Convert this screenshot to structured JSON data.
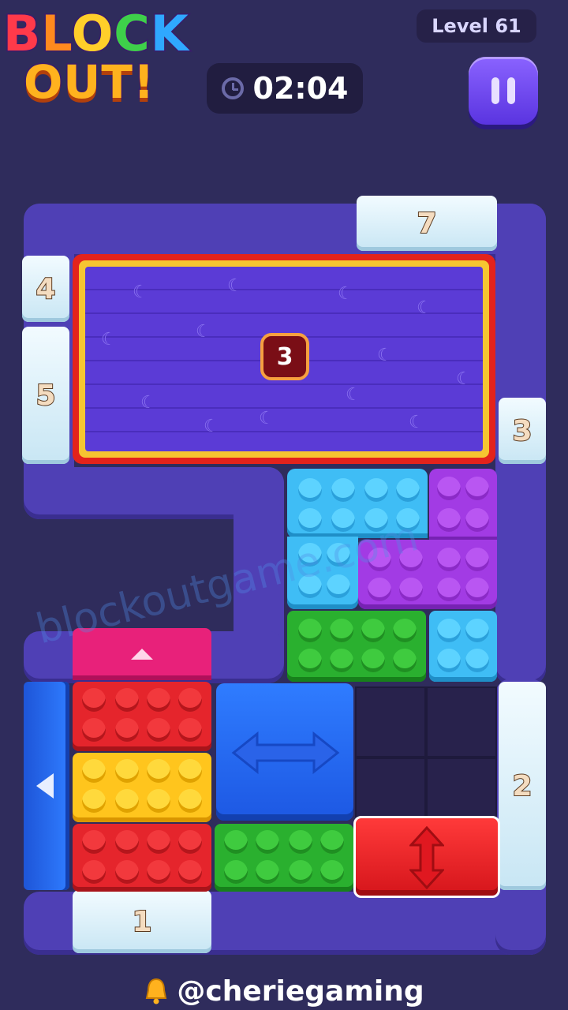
{
  "header": {
    "logo_line1": [
      "B",
      "L",
      "O",
      "C",
      "K"
    ],
    "logo_line2": "OUT!",
    "level": "Level 61",
    "timer": "02:04"
  },
  "board": {
    "gates": {
      "top": "7",
      "left_upper": "4",
      "left_lower": "5",
      "right_upper": "3",
      "right_lower": "2",
      "bottom": "1"
    },
    "big_block_count": "3"
  },
  "watermark": "blockoutgame.com",
  "footer": {
    "handle": "@cheriegaming"
  },
  "colors": {
    "background": "#2f2c5c",
    "wall": "#4f40b5",
    "cyan": "#3fbdf5",
    "purple": "#a23be4",
    "green": "#2ab02f",
    "red": "#e5252c",
    "yellow": "#ffc51d",
    "pink": "#e8217a",
    "blue": "#2f7cff"
  },
  "icons": [
    "clock-icon",
    "pause-icon",
    "bell-icon",
    "arrow-left-icon",
    "arrow-up-icon",
    "arrow-left-right-icon",
    "arrow-up-down-icon",
    "moon-icon"
  ]
}
